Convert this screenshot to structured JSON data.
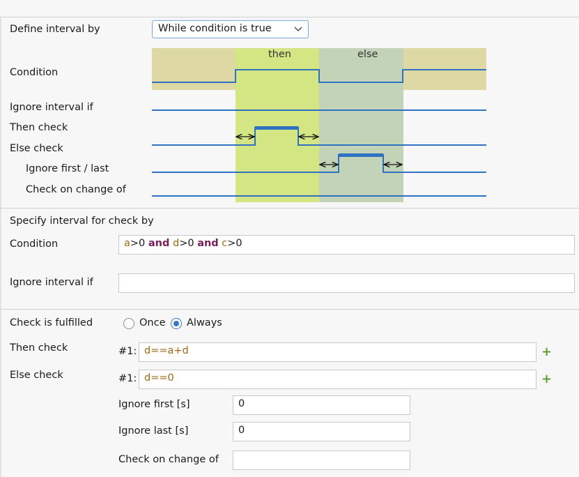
{
  "define": {
    "label": "Define interval by",
    "selected": "While condition is true"
  },
  "diagram": {
    "then_label": "then",
    "else_label": "else",
    "rows": {
      "condition": "Condition",
      "ignore_interval_if": "Ignore interval if",
      "then_check": "Then check",
      "else_check": "Else check",
      "ignore_first_last": "Ignore first / last",
      "check_on_change_of": "Check on change of"
    },
    "colors": {
      "outer": "#ded8a4",
      "then": "#d4e584",
      "else": "#c2d3b8",
      "signal": "#2f72c2"
    }
  },
  "specify": {
    "header": "Specify interval for check by",
    "condition_label": "Condition",
    "condition_tokens": [
      {
        "t": "a",
        "k": "var"
      },
      {
        "t": ">0 ",
        "k": "op"
      },
      {
        "t": "and",
        "k": "kw"
      },
      {
        "t": " ",
        "k": "op"
      },
      {
        "t": "d",
        "k": "var"
      },
      {
        "t": ">0 ",
        "k": "op"
      },
      {
        "t": "and",
        "k": "kw"
      },
      {
        "t": " ",
        "k": "op"
      },
      {
        "t": "c",
        "k": "var"
      },
      {
        "t": ">0",
        "k": "op"
      }
    ],
    "ignore_label": "Ignore interval if",
    "ignore_value": ""
  },
  "check": {
    "fulfilled_label": "Check is fulfilled",
    "option_once": "Once",
    "option_always": "Always",
    "selected_option": "Always",
    "then_label": "Then check",
    "then_prefix": "#1:",
    "then_value": "d==a+d",
    "else_label": "Else check",
    "else_prefix": "#1:",
    "else_value": "d==0",
    "ignore_first_label": "Ignore first [s]",
    "ignore_first_value": "0",
    "ignore_last_label": "Ignore last [s]",
    "ignore_last_value": "0",
    "change_label": "Check on change of",
    "change_value": "",
    "add_icon": "plus-icon"
  }
}
